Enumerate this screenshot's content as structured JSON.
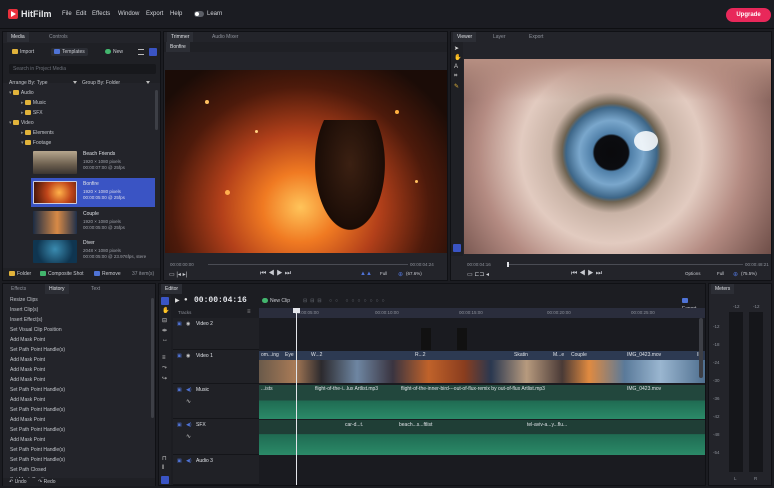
{
  "app": {
    "name": "HitFilm",
    "upgrade": "Upgrade",
    "learn": "Learn"
  },
  "menu": [
    "File",
    "Edit",
    "Effects",
    "Window",
    "Export",
    "Help"
  ],
  "media": {
    "tabs": [
      "Media",
      "Controls"
    ],
    "import": "Import",
    "templates": "Templates",
    "new": "New",
    "search_placeholder": "Search in Project Media",
    "arrange": "Arrange By: Type",
    "group": "Group By: Folder",
    "tree": [
      "Audio",
      "Music",
      "SFX",
      "Video",
      "Elements",
      "Footage"
    ],
    "clips": [
      {
        "name": "Beach Friends",
        "meta1": "1920 × 1080 pixels",
        "meta2": "00:00:07:00 @ 25fps"
      },
      {
        "name": "Bonfire",
        "meta1": "1920 × 1080 pixels",
        "meta2": "00:00:05:00 @ 25fps"
      },
      {
        "name": "Couple",
        "meta1": "1920 × 1080 pixels",
        "meta2": "00:00:05:00 @ 25fps"
      },
      {
        "name": "Diver",
        "meta1": "2048 × 1080 pixels",
        "meta2": "00:00:05:00 @ 23.976fps, stere"
      }
    ],
    "bottom": {
      "folder": "Folder",
      "composite": "Composite Shot",
      "remove": "Remove",
      "count": "37 item(s)"
    }
  },
  "trimmer": {
    "tabs": [
      "Trimmer",
      "Audio Mixer"
    ],
    "clip": "Bonfire",
    "time_left": "00:00:00:00",
    "time_right": "00:00:04:24",
    "full": "Full",
    "zoom": "(67.6%)"
  },
  "viewer": {
    "tabs": [
      "Viewer",
      "Layer",
      "Export"
    ],
    "time_left": "00:00:04:16",
    "time_right": "00:00:48:21",
    "options": "Options",
    "full": "Full",
    "zoom": "(75.5%)"
  },
  "history": {
    "tabs": [
      "Effects",
      "History",
      "Text"
    ],
    "items": [
      "Resize Clips",
      "Insert Clip(s)",
      "Insert Effect(s)",
      "Set Visual Clip Position",
      "Add Mask Point",
      "Set Path Point Handle(s)",
      "Add Mask Point",
      "Add Mask Point",
      "Add Mask Point",
      "Set Path Point Handle(s)",
      "Add Mask Point",
      "Set Path Point Handle(s)",
      "Add Mask Point",
      "Set Path Point Handle(s)",
      "Add Mask Point",
      "Set Path Point Handle(s)",
      "Set Path Point Handle(s)",
      "Set Path Closed",
      "Set Mask Position",
      "Set Path Point Handle(s)"
    ],
    "undo": "Undo",
    "redo": "Redo"
  },
  "editor": {
    "tab": "Editor",
    "timecode": "00:00:04:16",
    "new_clip": "New Clip",
    "export": "Export",
    "tracks_label": "Tracks",
    "ruler": [
      "00:00:05:00",
      "00:00:10:00",
      "00:00:15:00",
      "00:00:20:00",
      "00:00:25:00"
    ],
    "tracks": [
      "Video 2",
      "Video 1",
      "Music",
      "SFX",
      "Audio 3"
    ],
    "video_clip_labels": [
      "om...ing",
      "Eye",
      "W...2",
      "R...2",
      "Skatin",
      "M...e",
      "Couple",
      "IMG_0423.mov",
      "IM"
    ],
    "music_clip_labels": [
      "...ists",
      "flight-of-the-i...lux Artlist.mp3",
      "flight-of-the-inner-bird---out-of-flux-remix by out-of-flux Artlist.mp3",
      "IMG_0423.mov"
    ],
    "sfx_clip_labels": [
      "car-d...t.",
      "beach...s...ftlist",
      "tel-aviv-a...y...flu..."
    ]
  },
  "meters": {
    "tab": "Meters",
    "top": [
      "-12",
      "-12"
    ],
    "scale": [
      "-12",
      "-18",
      "-24",
      "-30",
      "-36",
      "-42",
      "-48",
      "-54"
    ],
    "lr": [
      "L",
      "R"
    ]
  },
  "colors": {
    "accent": "#e8285a",
    "selection": "#3a54c4",
    "video_clip": "#2d3a52",
    "audio_clip": "#1f5a48"
  }
}
